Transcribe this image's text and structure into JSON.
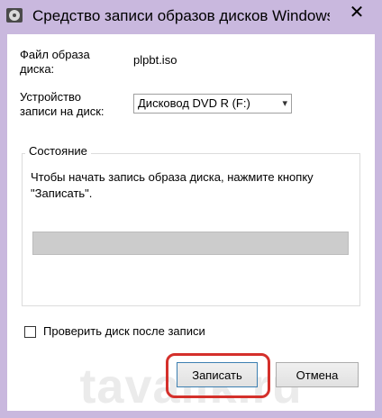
{
  "window": {
    "title": "Средство записи образов дисков Windows",
    "close_glyph": "✕"
  },
  "form": {
    "file_label_line1": "Файл образа",
    "file_label_line2": "диска:",
    "file_value": "plpbt.iso",
    "device_label_line1": "Устройство",
    "device_label_line2": "записи на диск:",
    "device_value": "Дисковод DVD R (F:)",
    "device_arrow": "▾"
  },
  "status": {
    "legend": "Состояние",
    "text": "Чтобы начать запись образа диска, нажмите кнопку \"Записать\".",
    "progress": 0
  },
  "verify": {
    "label": "Проверить диск после записи",
    "checked": false
  },
  "buttons": {
    "burn": "Записать",
    "cancel": "Отмена"
  },
  "watermark": "tavalik.ru",
  "colors": {
    "frame": "#c9b8de",
    "highlight": "#d4302b"
  }
}
